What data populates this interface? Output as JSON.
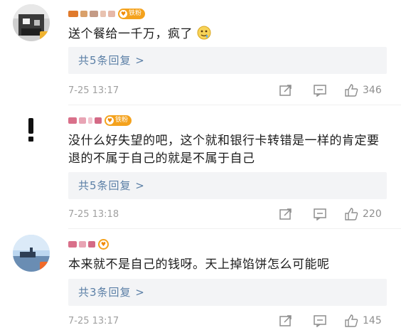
{
  "comments": [
    {
      "text": "送个餐给一千万，疯了",
      "emoji": "drooling-face",
      "badge": "铁粉",
      "replies": "共5条回复 >",
      "time": "7-25 13:17",
      "likes": "346"
    },
    {
      "text": "没什么好失望的吧，这个就和银行卡转错是一样的肯定要退的不属于自己的就是不属于自己",
      "badge": "铁粉",
      "replies": "共5条回复 >",
      "time": "7-25 13:18",
      "likes": "220"
    },
    {
      "text": "本来就不是自己的钱呀。天上掉馅饼怎么可能呢",
      "badge": "",
      "replies": "共3条回复 >",
      "time": "7-25 13:17",
      "likes": "145"
    }
  ],
  "icons": {
    "share": "share-icon",
    "comment": "comment-icon",
    "like": "thumbs-up-icon"
  },
  "colors": {
    "reply_link": "#5b7fa6",
    "badge": "#f4a21d",
    "reply_bg": "#f3f4f6"
  }
}
